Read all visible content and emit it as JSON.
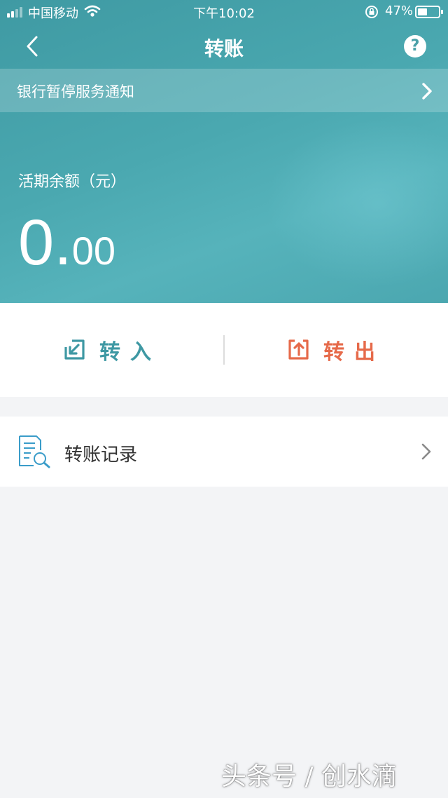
{
  "status_bar": {
    "carrier": "中国移动",
    "time": "下午10:02",
    "battery_percent": "47%",
    "battery_level": 0.47,
    "signal_bars": 2,
    "icons": [
      "signal-icon",
      "wifi-icon",
      "orientation-lock-icon",
      "battery-icon"
    ]
  },
  "nav": {
    "title": "转账",
    "back_icon": "chevron-left-icon",
    "help_icon": "question-circle-icon",
    "help_glyph": "?"
  },
  "notice": {
    "text": "银行暂停服务通知",
    "arrow_icon": "chevron-right-icon"
  },
  "balance": {
    "label": "活期余额（元）",
    "integer_part": "0",
    "separator": ".",
    "decimal_part": "00"
  },
  "actions": [
    {
      "label": "转入",
      "icon": "transfer-in-icon",
      "color": "#3e98a3"
    },
    {
      "label": "转出",
      "icon": "transfer-out-icon",
      "color": "#e66a4a"
    }
  ],
  "record": {
    "label": "转账记录",
    "icon": "document-search-icon",
    "arrow_icon": "chevron-right-icon"
  },
  "watermark": "头条号 / 创水滴",
  "colors": {
    "header_teal": "#4aa8b0",
    "transfer_in": "#3e98a3",
    "transfer_out": "#e66a4a",
    "page_background": "#f3f4f6"
  }
}
